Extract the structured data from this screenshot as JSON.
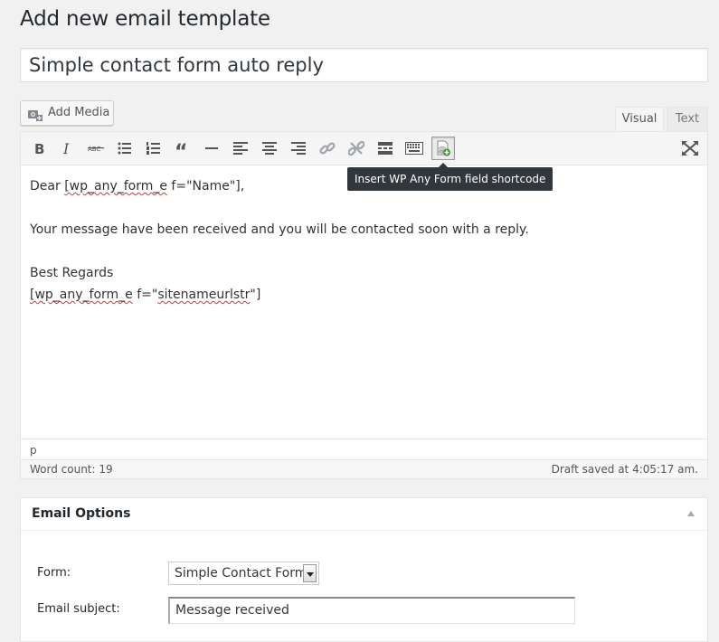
{
  "page": {
    "title": "Add new email template"
  },
  "title_field": {
    "value": "Simple contact form auto reply"
  },
  "media": {
    "add_media_label": "Add Media"
  },
  "editor": {
    "tabs": [
      {
        "label": "Visual",
        "active": true
      },
      {
        "label": "Text",
        "active": false
      }
    ],
    "toolbar": [
      {
        "name": "bold",
        "icon": "bold-icon"
      },
      {
        "name": "italic",
        "icon": "italic-icon"
      },
      {
        "name": "strikethrough",
        "icon": "strikethrough-icon"
      },
      {
        "name": "bulleted-list",
        "icon": "bulleted-list-icon"
      },
      {
        "name": "numbered-list",
        "icon": "numbered-list-icon"
      },
      {
        "name": "blockquote",
        "icon": "blockquote-icon"
      },
      {
        "name": "horizontal-line",
        "icon": "horizontal-line-icon"
      },
      {
        "name": "align-left",
        "icon": "align-left-icon"
      },
      {
        "name": "align-center",
        "icon": "align-center-icon"
      },
      {
        "name": "align-right",
        "icon": "align-right-icon"
      },
      {
        "name": "insert-link",
        "icon": "link-icon"
      },
      {
        "name": "remove-link",
        "icon": "unlink-icon"
      },
      {
        "name": "read-more",
        "icon": "read-more-icon"
      },
      {
        "name": "toolbar-toggle",
        "icon": "keyboard-icon"
      },
      {
        "name": "insert-form-field",
        "icon": "form-field-shortcode-icon"
      },
      {
        "name": "fullscreen",
        "icon": "fullscreen-icon"
      }
    ],
    "tooltip": "Insert WP Any Form field shortcode",
    "content": {
      "line1_prefix": "Dear ",
      "line1_shortcode_open": "[wp_any_form_e",
      "line1_rest": " f=\"Name\"],",
      "line2": "Your message have been received and you will be contacted soon with a reply.",
      "line3": "Best Regards",
      "line4_shortcode_open": "[wp_any_form_e",
      "line4_mid": " f=\"",
      "line4_squiggle": "sitenameurlstr",
      "line4_close": "\"]"
    },
    "path": "p",
    "word_count": "Word count: 19",
    "draft_status": "Draft saved at 4:05:17 am."
  },
  "email_options": {
    "title": "Email Options",
    "form_label": "Form:",
    "form_selected": "Simple Contact Form",
    "subject_label": "Email subject:",
    "subject_value": "Message received"
  }
}
